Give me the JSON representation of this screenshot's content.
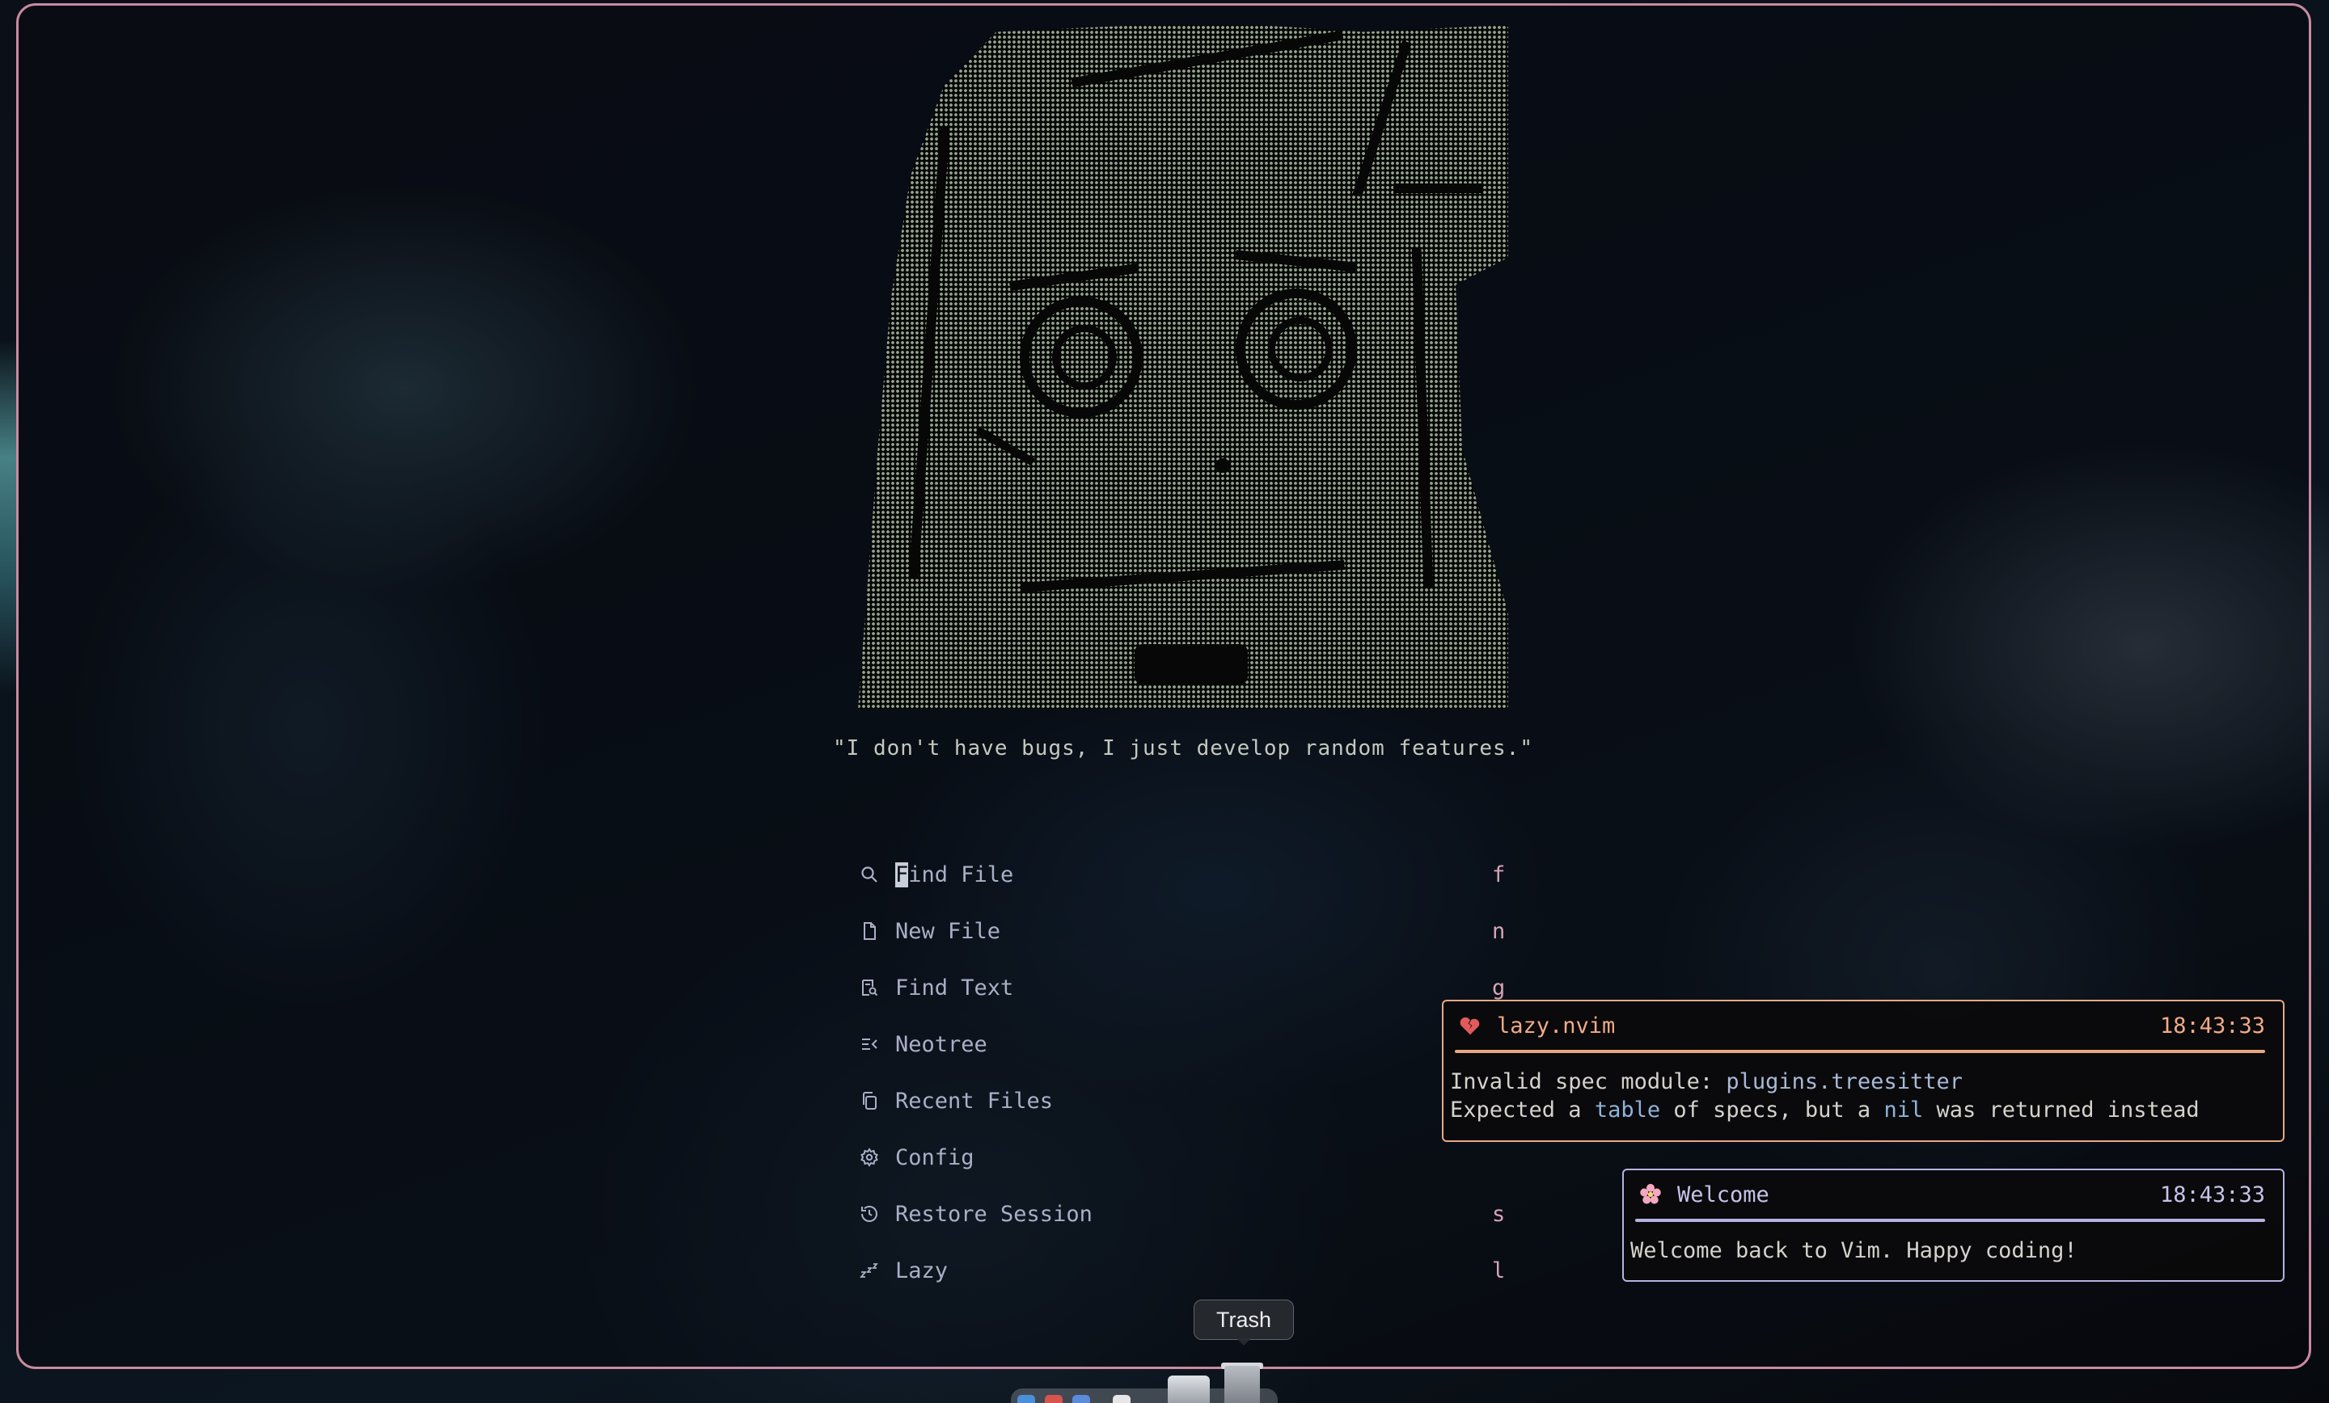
{
  "window": {
    "title": ""
  },
  "dashboard": {
    "quote": "\"I don't have bugs, I just develop random features.\"",
    "menu": [
      {
        "icon": "search-icon",
        "label": "Find File",
        "key": "f"
      },
      {
        "icon": "file-icon",
        "label": "New File",
        "key": "n"
      },
      {
        "icon": "find-text-icon",
        "label": "Find Text",
        "key": "g"
      },
      {
        "icon": "neotree-icon",
        "label": "Neotree",
        "key": ""
      },
      {
        "icon": "recent-files-icon",
        "label": "Recent Files",
        "key": ""
      },
      {
        "icon": "gear-icon",
        "label": "Config",
        "key": ""
      },
      {
        "icon": "restore-session-icon",
        "label": "Restore Session",
        "key": "s"
      },
      {
        "icon": "sleep-icon",
        "label": "Lazy",
        "key": "l"
      }
    ],
    "cursor_char": "F",
    "first_label_rest": "ind File"
  },
  "notifications": [
    {
      "icon": "broken-heart-icon",
      "title": "lazy.nvim",
      "time": "18:43:33",
      "line1_prefix": "Invalid spec module: ",
      "line1_module": "plugins.treesitter",
      "line2_a": "Expected a ",
      "line2_table": "table",
      "line2_b": " of specs, but a ",
      "line2_nil": "nil",
      "line2_c": " was returned instead",
      "color": "#e8a883"
    },
    {
      "icon": "blossom-icon",
      "title": "Welcome",
      "time": "18:43:33",
      "body": "Welcome back to Vim. Happy coding!",
      "color": "#b6b3e4"
    }
  ],
  "dock": {
    "tooltip": "Trash"
  },
  "colors": {
    "window_border": "#c98aa0",
    "menu_text": "#a9b0c6",
    "menu_key": "#d6a4b6",
    "ascii_art": "#95a48e"
  }
}
